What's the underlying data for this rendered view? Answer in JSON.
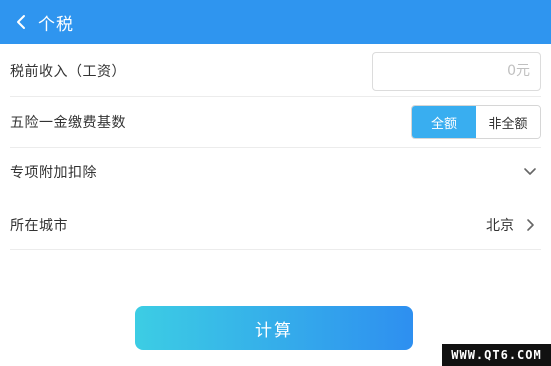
{
  "header": {
    "title": "个税",
    "back_icon": "chevron-left-icon"
  },
  "form": {
    "income": {
      "label": "税前收入（工资）",
      "value": "",
      "placeholder": "0元"
    },
    "insurance_base": {
      "label": "五险一金缴费基数",
      "options": [
        "全额",
        "非全额"
      ],
      "selected": "全额"
    },
    "special_deduction": {
      "label": "专项附加扣除",
      "icon": "chevron-down-icon"
    },
    "city": {
      "label": "所在城市",
      "value": "北京",
      "icon": "chevron-right-icon"
    }
  },
  "actions": {
    "calculate_label": "计算"
  },
  "watermark": {
    "text": "WWW.QT6.COM"
  },
  "colors": {
    "header_bg": "#2f95ef",
    "segment_active": "#39aef0",
    "button_gradient_start": "#3ccde4",
    "button_gradient_end": "#2e8ff0"
  }
}
